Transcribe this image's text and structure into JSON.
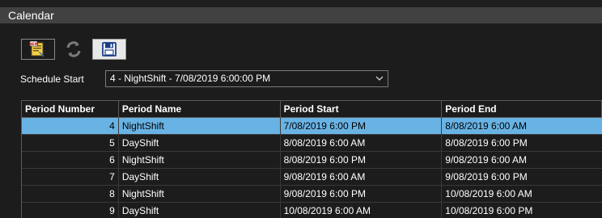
{
  "window": {
    "title": "Calendar"
  },
  "toolbar": {
    "buttons": [
      {
        "icon": "new-document-icon"
      },
      {
        "icon": "refresh-icon"
      },
      {
        "icon": "save-icon"
      }
    ]
  },
  "schedule": {
    "label": "Schedule Start",
    "selected": "4 - NightShift - 7/08/2019 6:00:00 PM"
  },
  "grid": {
    "columns": [
      "Period Number",
      "Period Name",
      "Period Start",
      "Period End"
    ],
    "rows": [
      {
        "number": "4",
        "name": "NightShift",
        "start": "7/08/2019 6:00 PM",
        "end": "8/08/2019 6:00 AM",
        "selected": true
      },
      {
        "number": "5",
        "name": "DayShift",
        "start": "8/08/2019 6:00 AM",
        "end": "8/08/2019 6:00 PM"
      },
      {
        "number": "6",
        "name": "NightShift",
        "start": "8/08/2019 6:00 PM",
        "end": "9/08/2019 6:00 AM"
      },
      {
        "number": "7",
        "name": "DayShift",
        "start": "9/08/2019 6:00 AM",
        "end": "9/08/2019 6:00 PM"
      },
      {
        "number": "8",
        "name": "NightShift",
        "start": "9/08/2019 6:00 PM",
        "end": "10/08/2019 6:00 AM"
      },
      {
        "number": "9",
        "name": "DayShift",
        "start": "10/08/2019 6:00 AM",
        "end": "10/08/2019 6:00 PM"
      }
    ]
  },
  "colors": {
    "selection": "#69b3e4",
    "titlebar": "#414141",
    "panel": "#1c1c1c"
  }
}
